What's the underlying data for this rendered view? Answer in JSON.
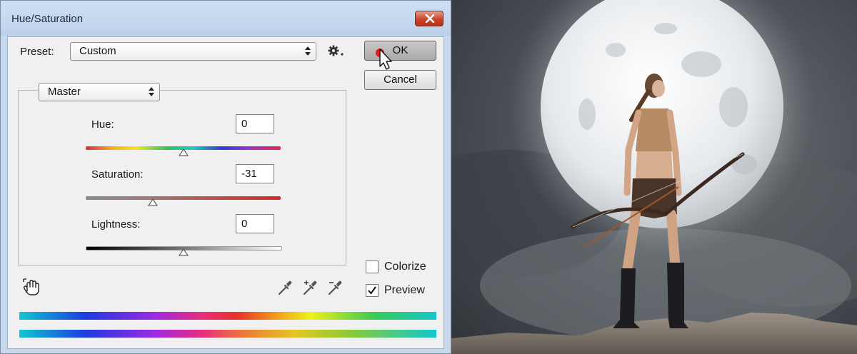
{
  "window": {
    "title": "Hue/Saturation"
  },
  "preset": {
    "label": "Preset:",
    "value": "Custom"
  },
  "buttons": {
    "ok": "OK",
    "cancel": "Cancel"
  },
  "channel": {
    "value": "Master"
  },
  "adjustments": {
    "hue": {
      "label": "Hue:",
      "value": "0",
      "slider_fraction": 0.5
    },
    "saturation": {
      "label": "Saturation:",
      "value": "-31",
      "slider_fraction": 0.345
    },
    "lightness": {
      "label": "Lightness:",
      "value": "0",
      "slider_fraction": 0.5
    }
  },
  "options": {
    "colorize": {
      "label": "Colorize",
      "checked": false
    },
    "preview": {
      "label": "Preview",
      "checked": true
    }
  },
  "icons": {
    "settings": "gear-icon",
    "targeted_adjustment": "hand-icon",
    "eyedroppers": [
      "eyedropper-icon",
      "eyedropper-plus-icon",
      "eyedropper-minus-icon"
    ]
  },
  "colors": {
    "close_button": "#c8452d",
    "ok_indicator": "#e02020"
  }
}
